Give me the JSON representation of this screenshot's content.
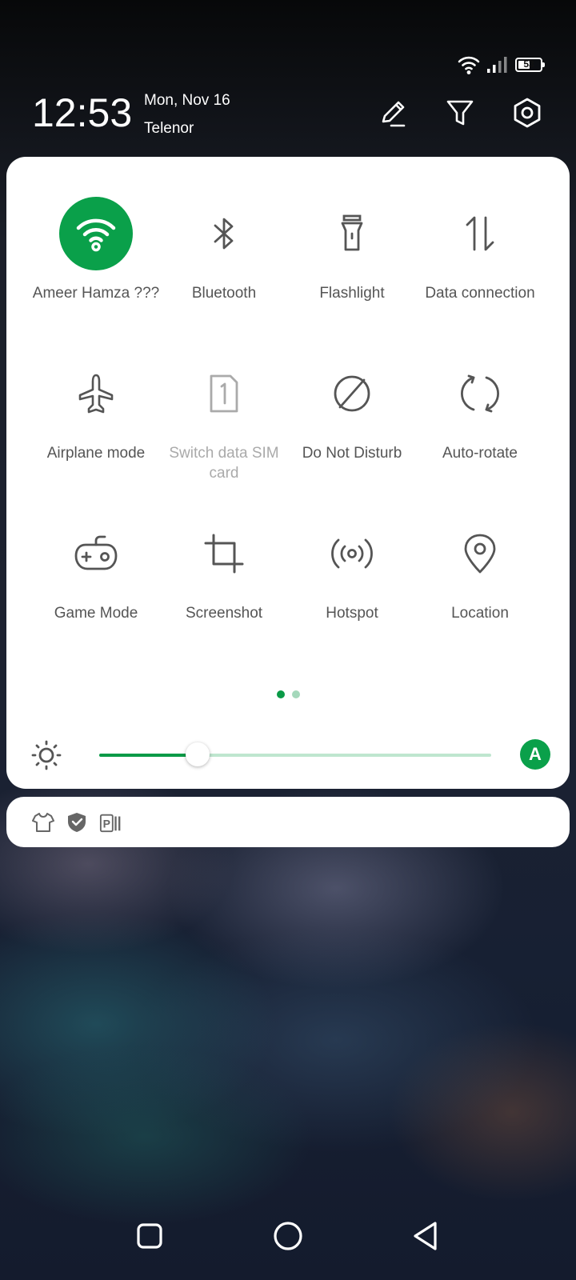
{
  "status_bar": {
    "battery_percent": "53",
    "icons": [
      "wifi-icon",
      "cellular-signal-icon",
      "battery-icon"
    ]
  },
  "header": {
    "time": "12:53",
    "date": "Mon, Nov 16",
    "carrier": "Telenor",
    "actions": [
      "edit-icon",
      "filter-icon",
      "settings-icon"
    ]
  },
  "quick_settings": {
    "tiles": [
      {
        "label": "Ameer Hamza ???",
        "icon": "wifi-icon",
        "active": true
      },
      {
        "label": "Bluetooth",
        "icon": "bluetooth-icon",
        "active": false
      },
      {
        "label": "Flashlight",
        "icon": "flashlight-icon",
        "active": false
      },
      {
        "label": "Data connection",
        "icon": "data-connection-icon",
        "active": false
      },
      {
        "label": "Airplane mode",
        "icon": "airplane-icon",
        "active": false
      },
      {
        "label": "Switch data SIM card",
        "icon": "sim-card-icon",
        "active": false,
        "disabled": true
      },
      {
        "label": "Do Not Disturb",
        "icon": "do-not-disturb-icon",
        "active": false
      },
      {
        "label": "Auto-rotate",
        "icon": "auto-rotate-icon",
        "active": false
      },
      {
        "label": "Game Mode",
        "icon": "gamepad-icon",
        "active": false
      },
      {
        "label": "Screenshot",
        "icon": "crop-icon",
        "active": false
      },
      {
        "label": "Hotspot",
        "icon": "hotspot-icon",
        "active": false
      },
      {
        "label": "Location",
        "icon": "location-pin-icon",
        "active": false
      }
    ],
    "page_count": 2,
    "current_page": 1,
    "brightness": {
      "level": 0.25,
      "auto_label": "A"
    },
    "colors": {
      "accent": "#0aa04a",
      "track": "#bfe6cf"
    }
  },
  "notifications": {
    "icons": [
      "tshirt-icon",
      "shield-check-icon",
      "parking-app-icon"
    ]
  },
  "nav_bar": {
    "buttons": [
      "recents-button",
      "home-button",
      "back-button"
    ]
  }
}
